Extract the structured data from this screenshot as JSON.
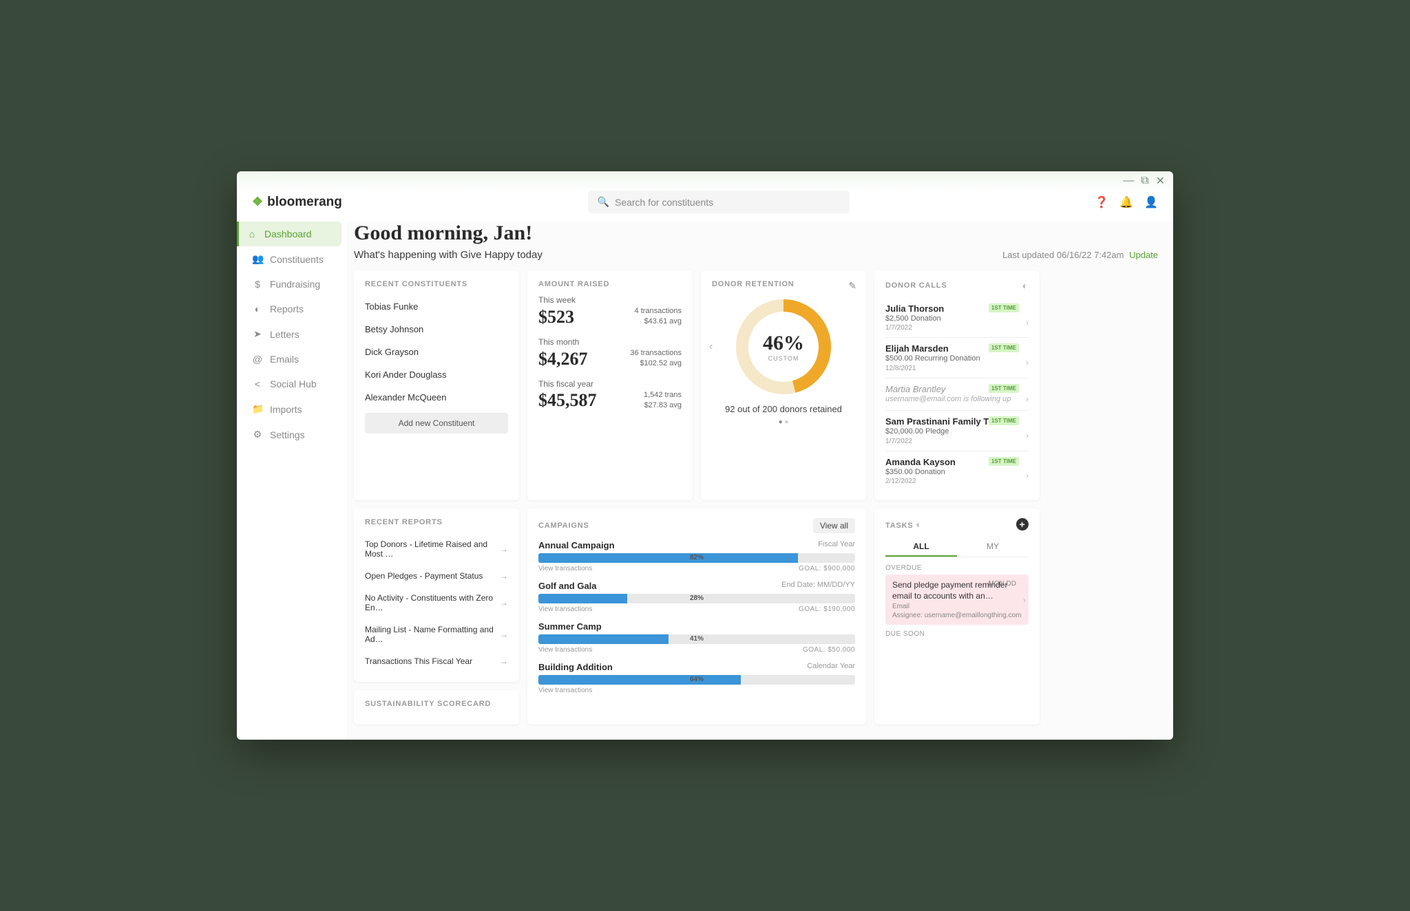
{
  "brand": "bloomerang",
  "search": {
    "placeholder": "Search for constituents"
  },
  "nav": [
    {
      "label": "Dashboard",
      "icon": "⌂"
    },
    {
      "label": "Constituents",
      "icon": "👥"
    },
    {
      "label": "Fundraising",
      "icon": "$"
    },
    {
      "label": "Reports",
      "icon": "◐"
    },
    {
      "label": "Letters",
      "icon": "➤"
    },
    {
      "label": "Emails",
      "icon": "@"
    },
    {
      "label": "Social Hub",
      "icon": "<"
    },
    {
      "label": "Imports",
      "icon": "📁"
    },
    {
      "label": "Settings",
      "icon": "⚙"
    }
  ],
  "greeting": "Good morning, Jan!",
  "subtitle": "What's happening with Give Happy today",
  "last_updated_prefix": "Last updated ",
  "last_updated": "06/16/22 7:42am",
  "update_link": "Update",
  "recent_constituents": {
    "title": "RECENT CONSTITUENTS",
    "items": [
      "Tobias Funke",
      "Betsy Johnson",
      "Dick Grayson",
      "Kori Ander Douglass",
      "Alexander McQueen"
    ],
    "add_label": "Add new Constituent"
  },
  "amount_raised": {
    "title": "AMOUNT RAISED",
    "blocks": [
      {
        "label": "This week",
        "amount": "$523",
        "trans": "4 transactions",
        "avg": "$43.61 avg"
      },
      {
        "label": "This month",
        "amount": "$4,267",
        "trans": "36 transactions",
        "avg": "$102.52 avg"
      },
      {
        "label": "This fiscal year",
        "amount": "$45,587",
        "trans": "1,542 trans",
        "avg": "$27.83 avg"
      }
    ]
  },
  "retention": {
    "title": "DONOR RETENTION",
    "percent": "46%",
    "percent_num": 46,
    "sublabel": "CUSTOM",
    "text": "92 out of 200 donors retained"
  },
  "donor_calls": {
    "title": "DONOR CALLS",
    "badge": "1ST TIME",
    "items": [
      {
        "name": "Julia Thorson",
        "meta": "$2,500 Donation",
        "date": "1/7/2022",
        "muted": false
      },
      {
        "name": "Elijah Marsden",
        "meta": "$500.00 Recurring Donation",
        "date": "12/8/2021",
        "muted": false
      },
      {
        "name": "Martia Brantley",
        "meta": "username@email.com is following up",
        "date": "",
        "muted": true
      },
      {
        "name": "Sam Prastinani Family Trust",
        "meta": "$20,000.00 Pledge",
        "date": "1/7/2022",
        "muted": false
      },
      {
        "name": "Amanda Kayson",
        "meta": "$350.00 Donation",
        "date": "2/12/2022",
        "muted": false
      }
    ]
  },
  "recent_reports": {
    "title": "RECENT REPORTS",
    "items": [
      "Top Donors - Lifetime Raised and Most …",
      "Open Pledges - Payment Status",
      "No Activity - Constituents with Zero En…",
      "Mailing List - Name Formatting and Ad…",
      "Transactions This Fiscal Year"
    ]
  },
  "campaigns": {
    "title": "CAMPAIGNS",
    "view_all": "View all",
    "view_trans": "View transactions",
    "goal_prefix": "GOAL: ",
    "items": [
      {
        "name": "Annual Campaign",
        "sub": "Fiscal Year",
        "pct": 82,
        "pct_label": "82%",
        "goal": "$900,000"
      },
      {
        "name": "Golf and Gala",
        "sub": "End Date: MM/DD/YY",
        "pct": 28,
        "pct_label": "28%",
        "goal": "$190,000"
      },
      {
        "name": "Summer Camp",
        "sub": "",
        "pct": 41,
        "pct_label": "41%",
        "goal": "$50,000"
      },
      {
        "name": "Building Addition",
        "sub": "Calendar Year",
        "pct": 64,
        "pct_label": "64%",
        "goal": ""
      }
    ]
  },
  "sustainability": {
    "title": "SUSTAINABILITY SCORECARD"
  },
  "tasks": {
    "title": "TASKS",
    "tab_all": "ALL",
    "tab_my": "MY",
    "overdue_label": "OVERDUE",
    "due_soon_label": "DUE SOON",
    "overdue": {
      "title": "Send pledge payment reminder email to accounts with an…",
      "type": "Email",
      "assignee": "Assignee: username@emaillongthing.com",
      "date": "MON DD"
    }
  }
}
